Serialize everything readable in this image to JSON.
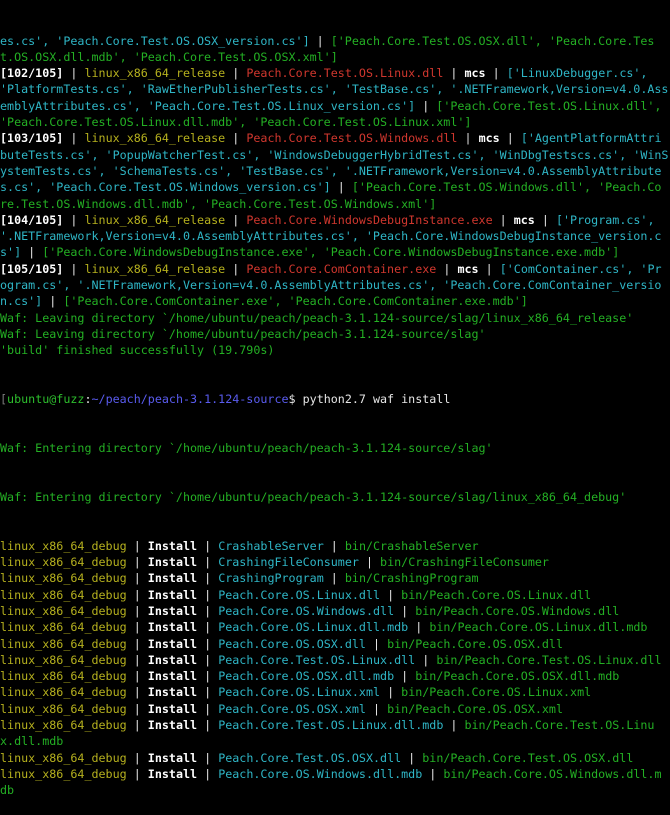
{
  "terminal": {
    "build_lines": [
      [
        [
          "c",
          "es.cs', 'Peach.Core.Test.OS.OSX_version.cs']"
        ],
        [
          "n",
          " | "
        ],
        [
          "g",
          "['Peach.Core.Test.OS.OSX.dll', 'Peach.Core.Test.OS.OSX.dll.mdb', 'Peach.Core.Test.OS.OSX.xml']"
        ]
      ],
      [
        [
          "w",
          "[102/105]"
        ],
        [
          "n",
          " | "
        ],
        [
          "y",
          "linux_x86_64_release"
        ],
        [
          "n",
          " | "
        ],
        [
          "r",
          "Peach.Core.Test.OS.Linux.dll"
        ],
        [
          "n",
          " | "
        ],
        [
          "w",
          "mcs"
        ],
        [
          "n",
          " | "
        ],
        [
          "c",
          "['LinuxDebugger.cs', 'PlatformTests.cs', 'RawEtherPublisherTests.cs', 'TestBase.cs', '.NETFramework,Version=v4.0.AssemblyAttributes.cs', 'Peach.Core.Test.OS.Linux_version.cs']"
        ],
        [
          "n",
          " | "
        ],
        [
          "g",
          "['Peach.Core.Test.OS.Linux.dll', 'Peach.Core.Test.OS.Linux.dll.mdb', 'Peach.Core.Test.OS.Linux.xml']"
        ]
      ],
      [
        [
          "w",
          "[103/105]"
        ],
        [
          "n",
          " | "
        ],
        [
          "y",
          "linux_x86_64_release"
        ],
        [
          "n",
          " | "
        ],
        [
          "r",
          "Peach.Core.Test.OS.Windows.dll"
        ],
        [
          "n",
          " | "
        ],
        [
          "w",
          "mcs"
        ],
        [
          "n",
          " | "
        ],
        [
          "c",
          "['AgentPlatformAttributeTests.cs', 'PopupWatcherTest.cs', 'WindowsDebuggerHybridTest.cs', 'WinDbgTestscs.cs', 'WinSystemTests.cs', 'SchemaTests.cs', 'TestBase.cs', '.NETFramework,Version=v4.0.AssemblyAttributes.cs', 'Peach.Core.Test.OS.Windows_version.cs']"
        ],
        [
          "n",
          " | "
        ],
        [
          "g",
          "['Peach.Core.Test.OS.Windows.dll', 'Peach.Core.Test.OS.Windows.dll.mdb', 'Peach.Core.Test.OS.Windows.xml']"
        ]
      ],
      [
        [
          "w",
          "[104/105]"
        ],
        [
          "n",
          " | "
        ],
        [
          "y",
          "linux_x86_64_release"
        ],
        [
          "n",
          " | "
        ],
        [
          "r",
          "Peach.Core.WindowsDebugInstance.exe"
        ],
        [
          "n",
          " | "
        ],
        [
          "w",
          "mcs"
        ],
        [
          "n",
          " | "
        ],
        [
          "c",
          "['Program.cs', '.NETFramework,Version=v4.0.AssemblyAttributes.cs', 'Peach.Core.WindowsDebugInstance_version.cs']"
        ],
        [
          "n",
          " | "
        ],
        [
          "g",
          "['Peach.Core.WindowsDebugInstance.exe', 'Peach.Core.WindowsDebugInstance.exe.mdb']"
        ]
      ],
      [
        [
          "w",
          "[105/105]"
        ],
        [
          "n",
          " | "
        ],
        [
          "y",
          "linux_x86_64_release"
        ],
        [
          "n",
          " | "
        ],
        [
          "r",
          "Peach.Core.ComContainer.exe"
        ],
        [
          "n",
          " | "
        ],
        [
          "w",
          "mcs"
        ],
        [
          "n",
          " | "
        ],
        [
          "c",
          "['ComContainer.cs', 'Program.cs', '.NETFramework,Version=v4.0.AssemblyAttributes.cs', 'Peach.Core.ComContainer_version.cs']"
        ],
        [
          "n",
          " | "
        ],
        [
          "g",
          "['Peach.Core.ComContainer.exe', 'Peach.Core.ComContainer.exe.mdb']"
        ]
      ],
      [
        [
          "g",
          "Waf: Leaving directory `/home/ubuntu/peach/peach-3.1.124-source/slag/linux_x86_64_release'"
        ]
      ],
      [
        [
          "g",
          "Waf: Leaving directory `/home/ubuntu/peach/peach-3.1.124-source/slag'"
        ]
      ],
      [
        [
          "g",
          "'build' finished successfully (19.790s)"
        ]
      ]
    ],
    "prompt": {
      "bracket": "[",
      "user_host": "ubuntu@fuzz",
      "colon": ":",
      "path": "~/peach/peach-3.1.124-source",
      "symbol": "$",
      "command": " python2.7 waf install"
    },
    "install_header_lines": [
      "Waf: Entering directory `/home/ubuntu/peach/peach-3.1.124-source/slag'",
      "Waf: Entering directory `/home/ubuntu/peach/peach-3.1.124-source/slag/linux_x86_64_debug'"
    ],
    "install": {
      "target": "linux_x86_64_debug",
      "action": "Install",
      "separator": " | ",
      "items": [
        {
          "name": "CrashableServer",
          "dest": "bin/CrashableServer"
        },
        {
          "name": "CrashingFileConsumer",
          "dest": "bin/CrashingFileConsumer"
        },
        {
          "name": "CrashingProgram",
          "dest": "bin/CrashingProgram"
        },
        {
          "name": "Peach.Core.OS.Linux.dll",
          "dest": "bin/Peach.Core.OS.Linux.dll"
        },
        {
          "name": "Peach.Core.OS.Windows.dll",
          "dest": "bin/Peach.Core.OS.Windows.dll"
        },
        {
          "name": "Peach.Core.OS.Linux.dll.mdb",
          "dest": "bin/Peach.Core.OS.Linux.dll.mdb"
        },
        {
          "name": "Peach.Core.OS.OSX.dll",
          "dest": "bin/Peach.Core.OS.OSX.dll"
        },
        {
          "name": "Peach.Core.Test.OS.Linux.dll",
          "dest": "bin/Peach.Core.Test.OS.Linux.dll"
        },
        {
          "name": "Peach.Core.OS.OSX.dll.mdb",
          "dest": "bin/Peach.Core.OS.OSX.dll.mdb"
        },
        {
          "name": "Peach.Core.OS.Linux.xml",
          "dest": "bin/Peach.Core.OS.Linux.xml"
        },
        {
          "name": "Peach.Core.OS.OSX.xml",
          "dest": "bin/Peach.Core.OS.OSX.xml"
        },
        {
          "name": "Peach.Core.Test.OS.Linux.dll.mdb",
          "dest": "bin/Peach.Core.Test.OS.Linux.dll.mdb"
        },
        {
          "name": "Peach.Core.Test.OS.OSX.dll",
          "dest": "bin/Peach.Core.Test.OS.OSX.dll"
        },
        {
          "name": "Peach.Core.OS.Windows.dll.mdb",
          "dest": "bin/Peach.Core.OS.Windows.dll.mdb"
        }
      ]
    },
    "colors": {
      "background": "#000000",
      "target": "#b5b01e",
      "output_file": "#d0372e",
      "sources": "#2fb6c6",
      "artifacts": "#24b024",
      "prompt_path": "#5a5cf0"
    }
  }
}
